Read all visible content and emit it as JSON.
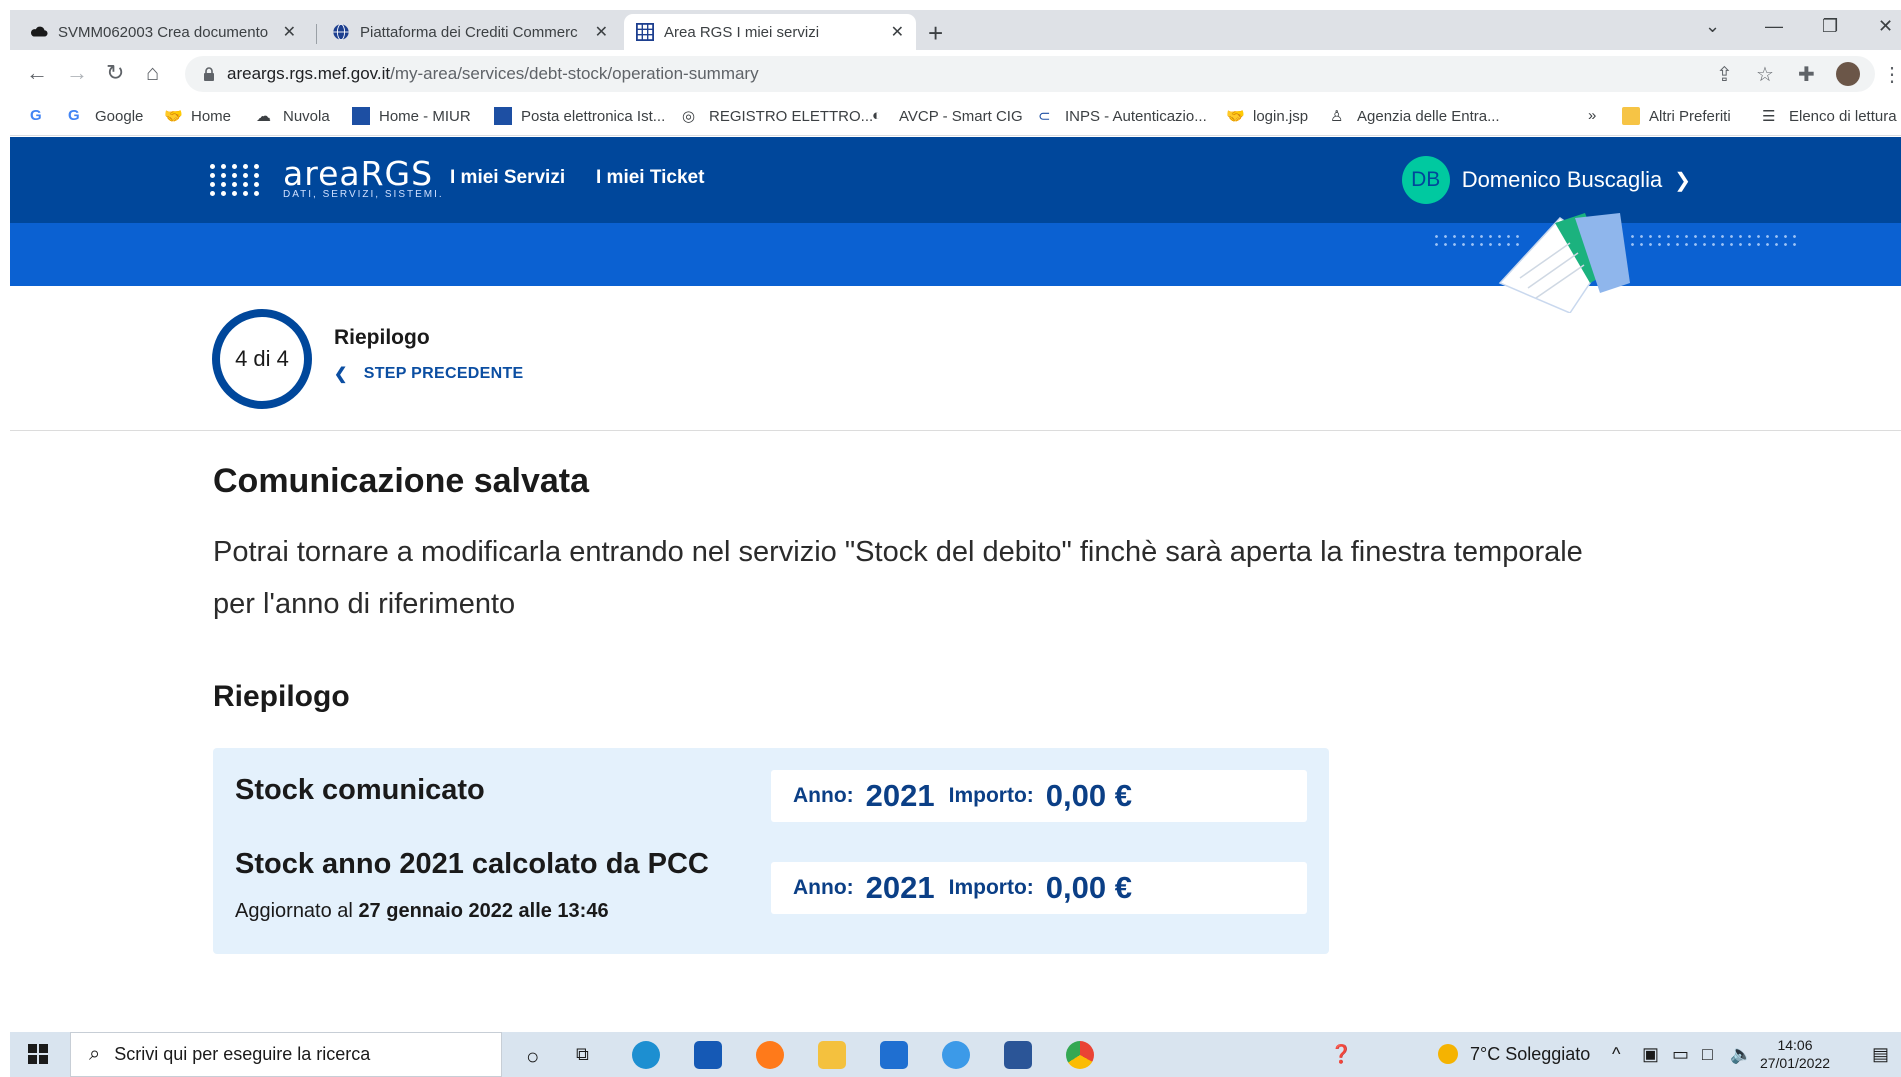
{
  "browser": {
    "tabs": [
      {
        "title": "SVMM062003 Crea documento",
        "active": false
      },
      {
        "title": "Piattaforma dei Crediti Commerc",
        "active": false
      },
      {
        "title": "Area RGS I miei servizi",
        "active": true
      }
    ],
    "close_glyph": "✕",
    "new_tab_glyph": "+",
    "url_host": "areargs.rgs.mef.gov.it",
    "url_path": "/my-area/services/debt-stock/operation-summary",
    "bookmarks": [
      {
        "label": "Google"
      },
      {
        "label": "Home"
      },
      {
        "label": "Nuvola"
      },
      {
        "label": "Home - MIUR"
      },
      {
        "label": "Posta elettronica Ist..."
      },
      {
        "label": "REGISTRO ELETTRO..."
      },
      {
        "label": "AVCP - Smart CIG"
      },
      {
        "label": "INPS - Autenticazio..."
      },
      {
        "label": "login.jsp"
      },
      {
        "label": "Agenzia delle Entra..."
      }
    ],
    "more_bookmarks": "»",
    "other_bookmarks": "Altri Preferiti",
    "reading_list": "Elenco di lettura"
  },
  "app": {
    "logo_brand": "areaRGS",
    "logo_tagline": "DATI, SERVIZI, SISTEMI.",
    "nav": [
      {
        "label": "I miei Servizi"
      },
      {
        "label": "I miei Ticket"
      }
    ],
    "user": {
      "initials": "DB",
      "name": "Domenico Buscaglia"
    }
  },
  "step": {
    "counter": "4 di 4",
    "title": "Riepilogo",
    "prev_label": "STEP PRECEDENTE"
  },
  "content": {
    "title": "Comunicazione salvata",
    "description": "Potrai tornare a modificarla entrando nel servizio \"Stock del debito\" finchè sarà aperta la finestra temporale per l'anno di riferimento",
    "summary_title": "Riepilogo",
    "rows": [
      {
        "label": "Stock comunicato",
        "sub_prefix": "",
        "sub_bold": "",
        "anno_label": "Anno:",
        "anno": "2021",
        "importo_label": "Importo:",
        "importo": "0,00 €"
      },
      {
        "label": "Stock anno 2021 calcolato da PCC",
        "sub_prefix": "Aggiornato al",
        "sub_bold": "27 gennaio 2022 alle 13:46",
        "anno_label": "Anno:",
        "anno": "2021",
        "importo_label": "Importo:",
        "importo": "0,00 €"
      }
    ]
  },
  "taskbar": {
    "search_placeholder": "Scrivi qui per eseguire la ricerca",
    "weather": "7°C Soleggiato",
    "time": "14:06",
    "date": "27/01/2022"
  },
  "colors": {
    "header": "#00479b",
    "hero": "#0b61d2",
    "card": "#e4f1fc",
    "accent_text": "#0b3f86",
    "avatar": "#00c9a0"
  }
}
